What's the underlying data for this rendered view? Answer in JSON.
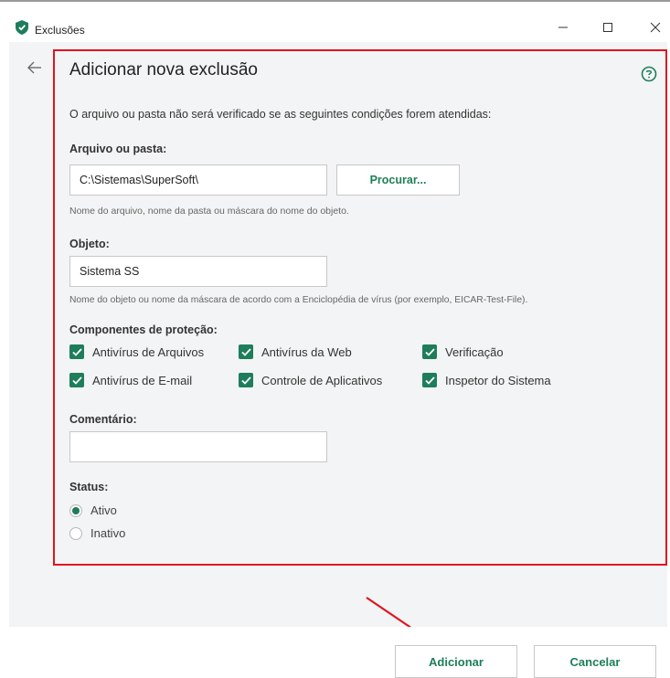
{
  "window": {
    "title": "Exclusões",
    "minimize_label": "–",
    "maximize_label": "□",
    "close_label": "×"
  },
  "page": {
    "back_label": "←",
    "title": "Adicionar nova exclusão",
    "description": "O arquivo ou pasta não será verificado se as seguintes condições forem atendidas:"
  },
  "file_or_folder": {
    "label": "Arquivo ou pasta:",
    "value": "C:\\Sistemas\\SuperSoft\\",
    "browse_label": "Procurar...",
    "hint": "Nome do arquivo, nome da pasta ou máscara do nome do objeto."
  },
  "object": {
    "label": "Objeto:",
    "value": "Sistema SS",
    "hint": "Nome do objeto ou nome da máscara de acordo com a Enciclopédia de vírus (por exemplo, EICAR-Test-File)."
  },
  "components": {
    "label": "Componentes de proteção:",
    "items": [
      {
        "label": "Antivírus de Arquivos",
        "checked": true
      },
      {
        "label": "Antivírus da Web",
        "checked": true
      },
      {
        "label": "Verificação",
        "checked": true
      },
      {
        "label": "Antivírus de E-mail",
        "checked": true
      },
      {
        "label": "Controle de Aplicativos",
        "checked": true
      },
      {
        "label": "Inspetor do Sistema",
        "checked": true
      }
    ]
  },
  "comment": {
    "label": "Comentário:",
    "value": ""
  },
  "status": {
    "label": "Status:",
    "options": [
      {
        "label": "Ativo",
        "selected": true
      },
      {
        "label": "Inativo",
        "selected": false
      }
    ]
  },
  "footer": {
    "add_label": "Adicionar",
    "cancel_label": "Cancelar"
  },
  "colors": {
    "accent": "#1e7d5a",
    "highlight": "#e0141f"
  },
  "icons": {
    "app": "shield-icon",
    "help": "help-icon",
    "back": "back-arrow-icon",
    "check": "check-icon"
  }
}
